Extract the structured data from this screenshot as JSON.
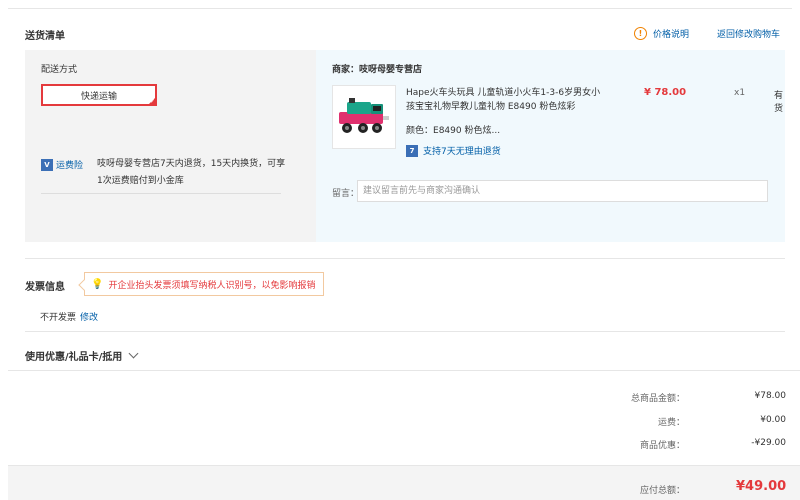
{
  "delivery": {
    "section_title": "送货清单",
    "price_explain": "价格说明",
    "back_to_cart": "返回修改购物车",
    "ship_method_label": "配送方式",
    "ship_method_value": "快递运输",
    "insurance_badge": "运费险",
    "insurance_text": "吱呀母婴专营店7天内退货，15天内换货，可享1次运费赔付到小金库",
    "merchant": "商家：吱呀母婴专营店",
    "product": {
      "title": "Hape火车头玩具 儿童轨道小火车1-3-6岁男女小孩宝宝礼物早教儿童礼物 E8490 粉色炫彩",
      "price": "¥ 78.00",
      "qty": "x1",
      "stock": "有货",
      "color_key": "颜色：",
      "color_value": "E8490 粉色炫...",
      "seven_day_icon": "7",
      "seven_day": "支持7天无理由退货"
    },
    "note_label": "留言：",
    "note_placeholder": "建议留言前先与商家沟通确认"
  },
  "invoice": {
    "section_title": "发票信息",
    "tip": "开企业抬头发票须填写纳税人识别号，以免影响报销",
    "value": "不开发票",
    "edit": "修改"
  },
  "coupon": {
    "label": "使用优惠/礼品卡/抵用"
  },
  "summary": {
    "rows": [
      {
        "label": "总商品金额：",
        "value": "¥78.00"
      },
      {
        "label": "运费：",
        "value": "¥0.00"
      },
      {
        "label": "商品优惠：",
        "value": "-¥29.00"
      }
    ],
    "total_label": "应付总额：",
    "total_value": "¥49.00"
  },
  "colors": {
    "accent_red": "#e4393c",
    "link_blue": "#005ea7",
    "right_panel_bg": "#f1f9fd"
  }
}
